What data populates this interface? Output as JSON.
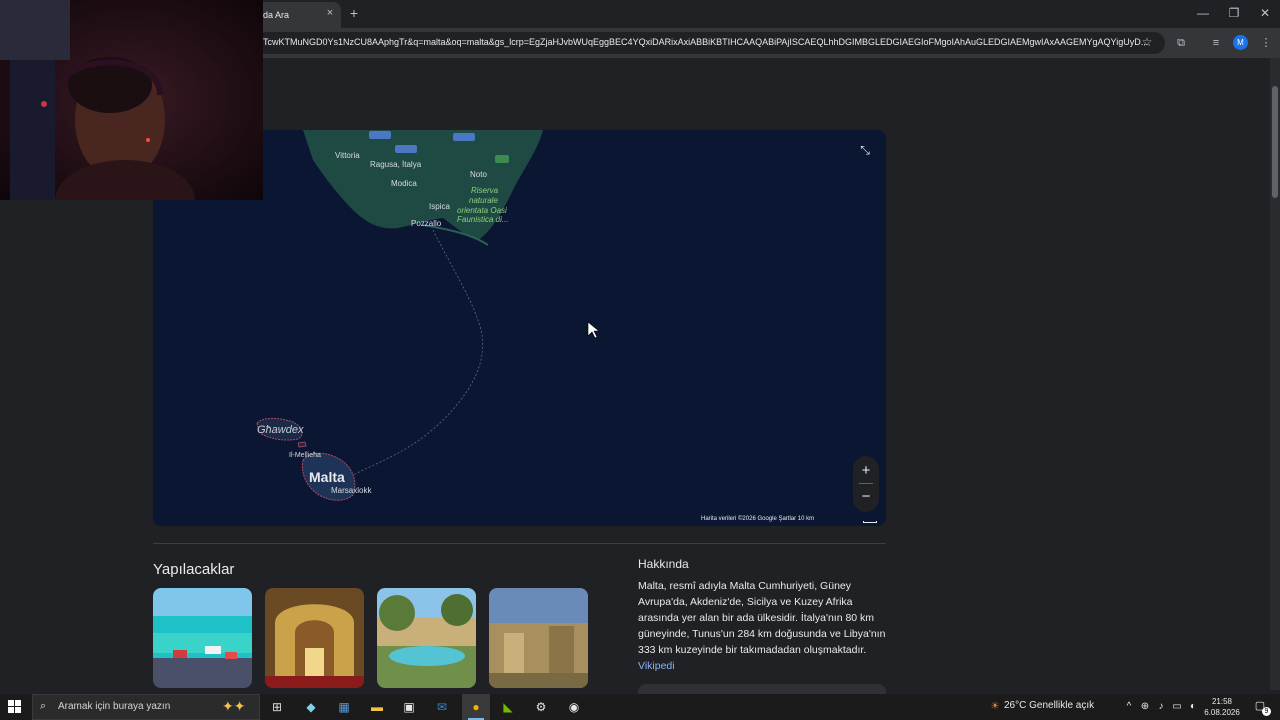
{
  "browser": {
    "tab_title": "da Ara",
    "tab_close": "×",
    "new_tab": "+",
    "address": "TcwKTMuNGD0Ys1NzCU8AAphgTr&q=malta&oq=malta&gs_lcrp=EgZjaHJvbWUqEggBEC4YQxiDARixAxiABBiKBTIHCAAQABiPAjISCAEQLhhDGIMBGLEDGIAEGIoFMgoIAhAuGLEDGIAEMgwIAxAAGEMYgAQYigUyD...",
    "profile_letter": "M",
    "min": "—",
    "restore": "❐",
    "close": "✕",
    "star": "☆",
    "ext_icon": "⧉",
    "media_icon": "≡",
    "menu_icon": "⋮"
  },
  "map": {
    "places": {
      "vittoria": "Vittoria",
      "ragusa": "Ragusa, İtalya",
      "modica": "Modica",
      "noto": "Noto",
      "ispica": "Ispica",
      "pozzallo": "Pozzallo",
      "riserva": "Riserva",
      "naturale": "naturale",
      "orientata": "orientata Oasi",
      "faunistica": "Faunistica di...",
      "ghawdex": "Għawdex",
      "mellieha": "Il-Mellieħa",
      "malta": "Malta",
      "marsaxlokk": "Marsaxlokk"
    },
    "zoom_in": "+",
    "zoom_out": "−",
    "fullscreen": "⤡",
    "footer": "Harita verileri ©2026 Google    Şartlar    10 km"
  },
  "todo": {
    "title": "Yapılacaklar"
  },
  "about": {
    "title": "Hakkında",
    "text": "Malta, resmî adıyla Malta Cumhuriyeti, Güney Avrupa'da, Akdeniz'de, Sicilya ve Kuzey Afrika arasında yer alan bir ada ülkesidir. İtalya'nın 80 km güneyinde, Tunus'un 284 km doğusunda ve Libya'nın 333 km kuzeyinde bir takımadadan oluşmaktadır.",
    "link": "Vikipedi"
  },
  "taskbar": {
    "search_placeholder": "Aramak için buraya yazın",
    "weather": "26°C  Genellikle açık",
    "time": "21:58",
    "date": "6.08.2026",
    "notif_count": "9"
  }
}
